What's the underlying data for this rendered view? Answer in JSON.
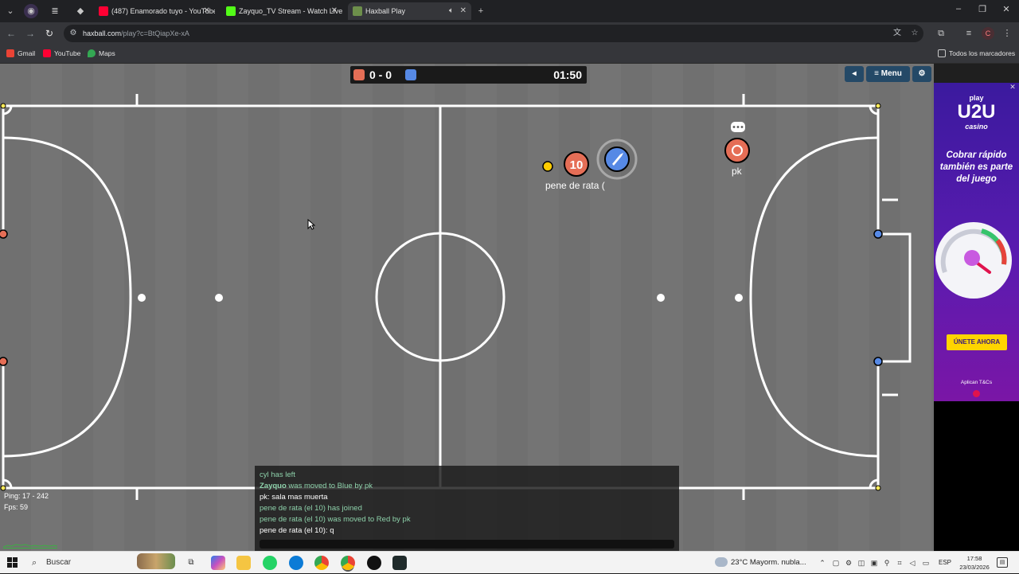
{
  "browser": {
    "tabs": [
      {
        "title": "(487) Enamorado tuyo - YouTube",
        "favicon_color": "#ff0033",
        "active": false
      },
      {
        "title": "Zayquo_TV Stream - Watch Live",
        "favicon_color": "#53fc18",
        "active": false
      },
      {
        "title": "Haxball Play",
        "favicon_color": "#6d8f4b",
        "active": true
      }
    ],
    "new_tab_label": "+",
    "url_host": "haxball.com",
    "url_rest": "/play?c=BtQiapXe-xA",
    "bookmarks": [
      {
        "label": "Gmail",
        "color": "#ea4335"
      },
      {
        "label": "YouTube",
        "color": "#ff0033"
      },
      {
        "label": "Maps",
        "color": "#34a853"
      }
    ],
    "all_bookmarks_label": "Todos los marcadores",
    "profile_initial": "C"
  },
  "game": {
    "score": "0 - 0",
    "timer": "01:50",
    "red_color": "#e56e56",
    "blue_color": "#5689e5",
    "buttons": {
      "sound": "◂",
      "menu": "≡ Menu",
      "settings": "⚙"
    },
    "players": [
      {
        "name": "pene de rata (",
        "avatar": "10",
        "team": "red"
      },
      {
        "name": "",
        "avatar": "rocket-icon",
        "team": "blue"
      },
      {
        "name": "pk",
        "avatar": "",
        "team": "red"
      }
    ],
    "stats": {
      "ping": "Ping: 17 - 242",
      "fps": "Fps: 59"
    },
    "chat": [
      {
        "text": "cyl has left",
        "kind": "notice"
      },
      {
        "bold": "Zayquo",
        "text": " was moved to Blue by pk",
        "kind": "notice"
      },
      {
        "text": "pk: sala mas muerta",
        "kind": "msg"
      },
      {
        "text": "pene de rata (el 10) has joined",
        "kind": "notice"
      },
      {
        "text": "pene de rata (el 10) was moved to Red by pk",
        "kind": "notice"
      },
      {
        "text": "pene de rata (el 10): q",
        "kind": "msg"
      }
    ]
  },
  "ad": {
    "brand_top": "play",
    "brand": "U2U",
    "brand_sub": "casino",
    "headline": "Cobrar rápido también es parte del juego",
    "cta": "ÚNETE AHORA",
    "terms": "Aplican T&Cs"
  },
  "taskbar": {
    "search_placeholder": "Buscar",
    "weather": "23°C  Mayorm. nubla...",
    "language": "ESP",
    "time": "17:58",
    "date": "23/03/2026"
  }
}
